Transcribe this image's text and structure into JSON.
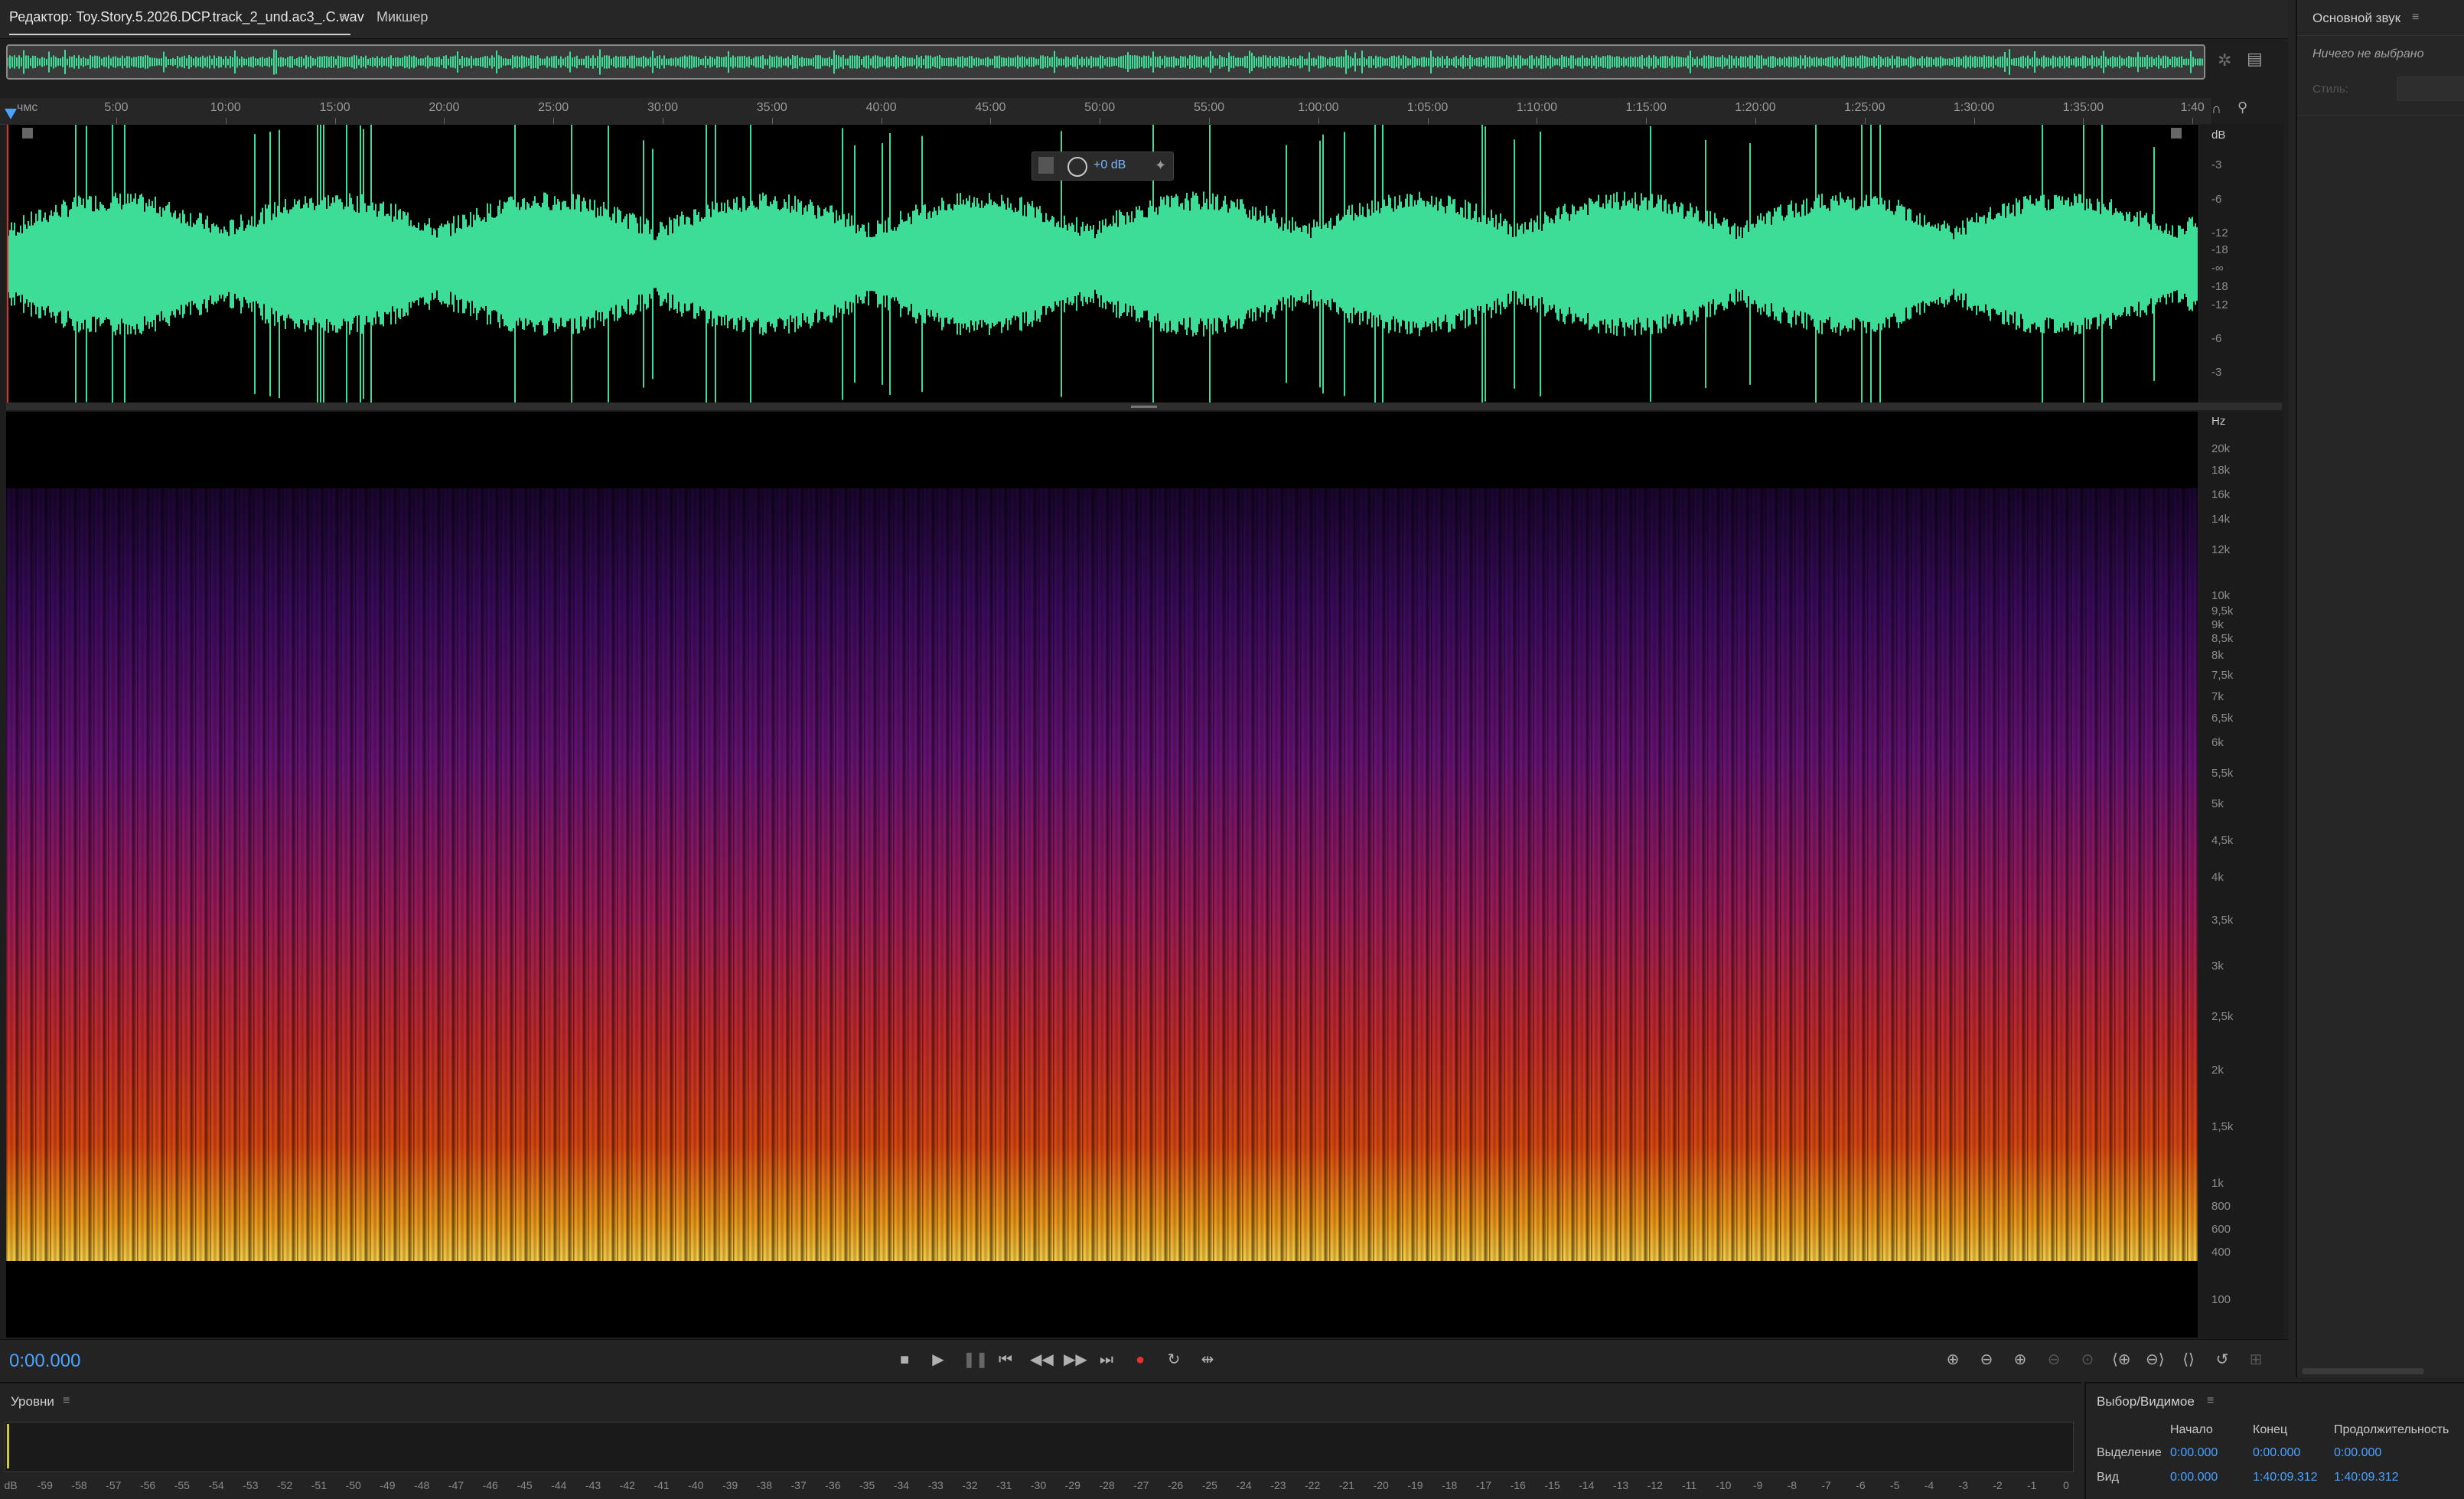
{
  "tabs": {
    "editor": "Редактор: Toy.Story.5.2026.DCP.track_2_und.ac3_.C.wav",
    "mixer": "Микшер"
  },
  "ruler": {
    "unit": "чмс",
    "ticks": [
      "5:00",
      "10:00",
      "15:00",
      "20:00",
      "25:00",
      "30:00",
      "35:00",
      "40:00",
      "45:00",
      "50:00",
      "55:00",
      "1:00:00",
      "1:05:00",
      "1:10:00",
      "1:15:00",
      "1:20:00",
      "1:25:00",
      "1:30:00",
      "1:35:00",
      "1:40"
    ]
  },
  "waveform": {
    "db_unit": "dB",
    "db_labels": [
      "-3",
      "-6",
      "-12",
      "-18",
      "-∞",
      "-18",
      "-12",
      "-6",
      "-3"
    ],
    "color": "#3ddc97"
  },
  "hud": {
    "gain": "+0 dB"
  },
  "spectrogram": {
    "hz_unit": "Hz",
    "hz_labels": [
      "20k",
      "18k",
      "16k",
      "14k",
      "12k",
      "10k",
      "9,5k",
      "9k",
      "8,5k",
      "8k",
      "7,5k",
      "7k",
      "6,5k",
      "6k",
      "5,5k",
      "5k",
      "4,5k",
      "4k",
      "3,5k",
      "3k",
      "2,5k",
      "2k",
      "1,5k",
      "1k",
      "800",
      "600",
      "400",
      "100"
    ]
  },
  "transport": {
    "timecode": "0:00.000"
  },
  "essential_sound": {
    "title": "Основной звук",
    "note": "Ничего не выбрано",
    "style_label": "Стиль:"
  },
  "levels": {
    "title": "Уровни",
    "scale": [
      "dB",
      "-59",
      "-58",
      "-57",
      "-56",
      "-55",
      "-54",
      "-53",
      "-52",
      "-51",
      "-50",
      "-49",
      "-48",
      "-47",
      "-46",
      "-45",
      "-44",
      "-43",
      "-42",
      "-41",
      "-40",
      "-39",
      "-38",
      "-37",
      "-36",
      "-35",
      "-34",
      "-33",
      "-32",
      "-31",
      "-30",
      "-29",
      "-28",
      "-27",
      "-26",
      "-25",
      "-24",
      "-23",
      "-22",
      "-21",
      "-20",
      "-19",
      "-18",
      "-17",
      "-16",
      "-15",
      "-14",
      "-13",
      "-12",
      "-11",
      "-10",
      "-9",
      "-8",
      "-7",
      "-6",
      "-5",
      "-4",
      "-3",
      "-2",
      "-1",
      "0"
    ]
  },
  "selection": {
    "title": "Выбор/Видимое",
    "headers": {
      "start": "Начало",
      "end": "Конец",
      "duration": "Продолжительность"
    },
    "rows": [
      {
        "label": "Выделение",
        "start": "0:00.000",
        "end": "0:00.000",
        "duration": "0:00.000"
      },
      {
        "label": "Вид",
        "start": "0:00.000",
        "end": "1:40:09.312",
        "duration": "1:40:09.312"
      }
    ]
  },
  "icons": {
    "play": "play-icon",
    "stop": "stop-icon",
    "pause": "pause-icon",
    "record": "record-icon",
    "zoom_in": "zoom-in-icon",
    "zoom_out": "zoom-out-icon"
  },
  "colors": {
    "accent_blue": "#4aa3ff",
    "waveform": "#3ddc97",
    "record": "#e5322e"
  }
}
